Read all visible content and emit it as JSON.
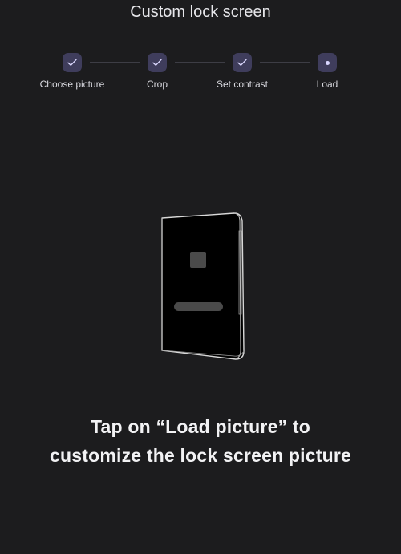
{
  "header": {
    "title": "Custom lock screen"
  },
  "stepper": {
    "steps": [
      {
        "label": "Choose picture",
        "status": "completed",
        "icon": "check-icon"
      },
      {
        "label": "Crop",
        "status": "completed",
        "icon": "check-icon"
      },
      {
        "label": "Set contrast",
        "status": "completed",
        "icon": "check-icon"
      },
      {
        "label": "Load",
        "status": "current",
        "icon": "dot-icon"
      }
    ]
  },
  "illustration": {
    "icon": "foldable-phone-icon"
  },
  "message": {
    "line1": "Tap on “Load picture” to",
    "line2": "customize the lock screen picture"
  },
  "colors": {
    "background": "#1c1c1e",
    "step_circle": "#3f3d5c",
    "step_accent": "#d9d6ff"
  }
}
